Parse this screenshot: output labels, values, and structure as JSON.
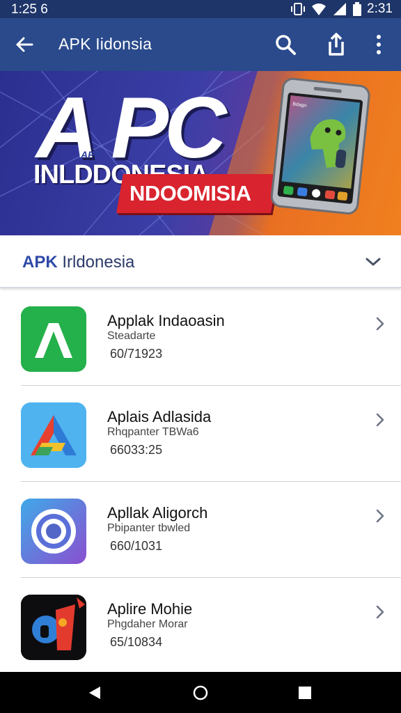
{
  "status_bar": {
    "time_left": "1:25 6",
    "time_right": "2:31"
  },
  "app_bar": {
    "title": "APK Iidonsia"
  },
  "banner": {
    "big_letters": "A PC",
    "small_app": "APP",
    "line1": "INLDDONESIA",
    "ribbon": "NDOOMISIA",
    "phone_label": "Bdago"
  },
  "section": {
    "accent": "APK",
    "rest": " Irldonesia"
  },
  "apps": [
    {
      "name": "Applak Indaoasin",
      "sub": "Steadarte",
      "num": "60/71923"
    },
    {
      "name": "Aplais Adlasida",
      "sub": "Rhqpanter TBWa6",
      "num": "66033:25"
    },
    {
      "name": "Apllak Aligorch",
      "sub": "Pbipanter tbwled",
      "num": "660/1031"
    },
    {
      "name": "Aplire Mohie",
      "sub": "Phgdaher Morar",
      "num": "65/10834"
    }
  ],
  "colors": {
    "app_bar": "#2a4a8c",
    "status_bar": "#1e3569",
    "accent": "#2f4aa8"
  },
  "icons": [
    "back-arrow-icon",
    "search-icon",
    "share-icon",
    "more-vert-icon",
    "chevron-down-icon",
    "chevron-right-icon"
  ]
}
